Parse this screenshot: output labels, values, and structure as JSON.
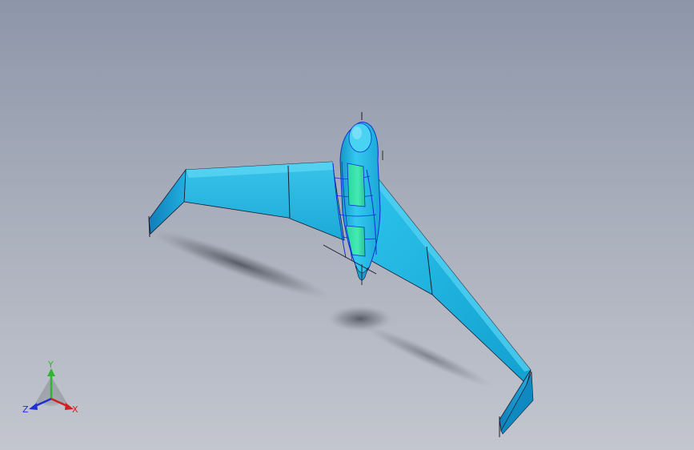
{
  "view": {
    "background_top": "#8d96a9",
    "background_bottom": "#c3c6cf"
  },
  "model": {
    "body_color": "#1fb5e0",
    "highlight_color": "#3fe8a8",
    "edge_color": "#1a1a2e",
    "selection_edge_color": "#1030d0"
  },
  "triad": {
    "y_label": "Y",
    "x_label": "X",
    "z_label": "Z",
    "y_color": "#2fb52f",
    "x_color": "#d02020",
    "z_color": "#2030d0"
  }
}
